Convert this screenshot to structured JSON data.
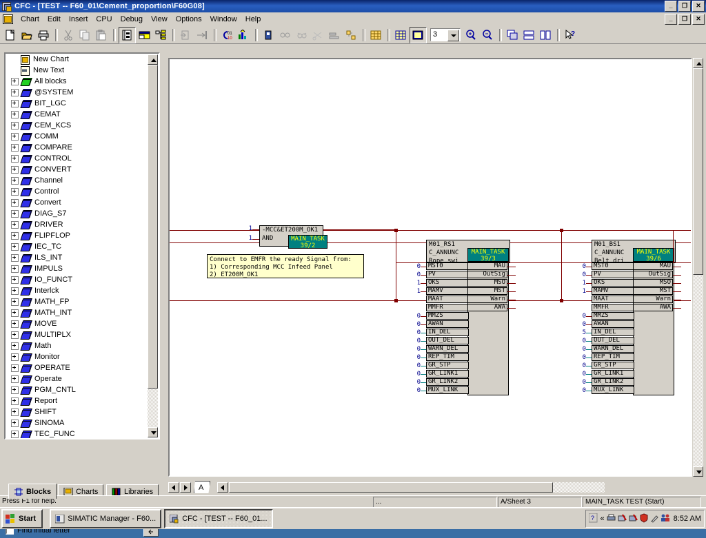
{
  "window": {
    "title": "CFC - [TEST -- F60_01\\Cement_proportion\\F60G08]",
    "min": "_",
    "max": "❐",
    "close": "✕",
    "child_min": "_",
    "child_max": "❐",
    "child_close": "✕"
  },
  "menu": [
    "Chart",
    "Edit",
    "Insert",
    "CPU",
    "Debug",
    "View",
    "Options",
    "Window",
    "Help"
  ],
  "toolbar": {
    "zoom_value": "3",
    "items": [
      "new-icon",
      "open-icon",
      "print-icon",
      "cut-icon",
      "copy-icon",
      "paste-icon",
      "chart-view-icon",
      "sheet-view-icon",
      "tree-view-icon",
      "goto-icon",
      "insert-input-icon",
      "compile-icon",
      "download-icon",
      "test-mode-icon",
      "watch-icon",
      "monitor-icon",
      "disconnect-icon",
      "align-icon",
      "distribute-icon",
      "layout-icon",
      "grid-icon",
      "page-icon",
      "zoom-in-icon",
      "zoom-out-icon",
      "cascade-icon",
      "tile-horiz-icon",
      "tile-vert-icon",
      "help-cursor-icon"
    ]
  },
  "sidebar": {
    "tree": [
      {
        "label": "New Chart",
        "icon": "chart-doc-icon",
        "expandable": false
      },
      {
        "label": "New Text",
        "icon": "text-doc-icon",
        "expandable": false
      },
      {
        "label": "All blocks",
        "icon": "green-book-icon",
        "expandable": true
      },
      {
        "label": "@SYSTEM",
        "icon": "blue-book-icon",
        "expandable": true
      },
      {
        "label": "BIT_LGC",
        "icon": "blue-book-icon",
        "expandable": true
      },
      {
        "label": "CEMAT",
        "icon": "blue-book-icon",
        "expandable": true
      },
      {
        "label": "CEM_KCS",
        "icon": "blue-book-icon",
        "expandable": true
      },
      {
        "label": "COMM",
        "icon": "blue-book-icon",
        "expandable": true
      },
      {
        "label": "COMPARE",
        "icon": "blue-book-icon",
        "expandable": true
      },
      {
        "label": "CONTROL",
        "icon": "blue-book-icon",
        "expandable": true
      },
      {
        "label": "CONVERT",
        "icon": "blue-book-icon",
        "expandable": true
      },
      {
        "label": "Channel",
        "icon": "blue-book-icon",
        "expandable": true
      },
      {
        "label": "Control",
        "icon": "blue-book-icon",
        "expandable": true
      },
      {
        "label": "Convert",
        "icon": "blue-book-icon",
        "expandable": true
      },
      {
        "label": "DIAG_S7",
        "icon": "blue-book-icon",
        "expandable": true
      },
      {
        "label": "DRIVER",
        "icon": "blue-book-icon",
        "expandable": true
      },
      {
        "label": "FLIPFLOP",
        "icon": "blue-book-icon",
        "expandable": true
      },
      {
        "label": "IEC_TC",
        "icon": "blue-book-icon",
        "expandable": true
      },
      {
        "label": "ILS_INT",
        "icon": "blue-book-icon",
        "expandable": true
      },
      {
        "label": "IMPULS",
        "icon": "blue-book-icon",
        "expandable": true
      },
      {
        "label": "IO_FUNCT",
        "icon": "blue-book-icon",
        "expandable": true
      },
      {
        "label": "Interlck",
        "icon": "blue-book-icon",
        "expandable": true
      },
      {
        "label": "MATH_FP",
        "icon": "blue-book-icon",
        "expandable": true
      },
      {
        "label": "MATH_INT",
        "icon": "blue-book-icon",
        "expandable": true
      },
      {
        "label": "MOVE",
        "icon": "blue-book-icon",
        "expandable": true
      },
      {
        "label": "MULTIPLX",
        "icon": "blue-book-icon",
        "expandable": true
      },
      {
        "label": "Math",
        "icon": "blue-book-icon",
        "expandable": true
      },
      {
        "label": "Monitor",
        "icon": "blue-book-icon",
        "expandable": true
      },
      {
        "label": "OPERATE",
        "icon": "blue-book-icon",
        "expandable": true
      },
      {
        "label": "Operate",
        "icon": "blue-book-icon",
        "expandable": true
      },
      {
        "label": "PGM_CNTL",
        "icon": "blue-book-icon",
        "expandable": true
      },
      {
        "label": "Report",
        "icon": "blue-book-icon",
        "expandable": true
      },
      {
        "label": "SHIFT",
        "icon": "blue-book-icon",
        "expandable": true
      },
      {
        "label": "SINOMA",
        "icon": "blue-book-icon",
        "expandable": true
      },
      {
        "label": "TEC_FUNC",
        "icon": "blue-book-icon",
        "expandable": true
      }
    ],
    "tabs": [
      {
        "label": "Blocks",
        "active": true,
        "icon": "blocks-icon"
      },
      {
        "label": "Charts",
        "active": false,
        "icon": "charts-icon"
      },
      {
        "label": "Libraries",
        "active": false,
        "icon": "libraries-icon"
      }
    ],
    "search_value": "",
    "search_placeholder": "",
    "find_initial_letter": "Find initial letter",
    "find_button": "find-binoculars-icon",
    "jump_button": "jump-icon"
  },
  "canvas": {
    "and_block": {
      "name": "-MCC&ET200M_OK1",
      "type": "AND",
      "task": "MAIN_TASK",
      "task_pos": "39/2",
      "input_values": [
        "1",
        "1"
      ]
    },
    "comment": "Connect to EMFR the ready Signal from:\n1) Corresponding MCC Infeed Panel\n2) ET200M_OK1",
    "blocks": [
      {
        "name": "M01_RS1",
        "type": "C_ANNUNC",
        "comment": "Rope swi",
        "task": "MAIN_TASK",
        "task_pos": "39/3",
        "inputs": [
          {
            "pin": "MST0",
            "value": "0"
          },
          {
            "pin": "PV",
            "value": "0"
          },
          {
            "pin": "OKS",
            "value": "1"
          },
          {
            "pin": "MAMV",
            "value": "1"
          },
          {
            "pin": "MAAT",
            "value": ""
          },
          {
            "pin": "MMFR",
            "value": ""
          },
          {
            "pin": "MMZS",
            "value": "0"
          },
          {
            "pin": "AWAN",
            "value": "0"
          },
          {
            "pin": "IN_DEL",
            "value": "0"
          },
          {
            "pin": "OUT_DEL",
            "value": "0"
          },
          {
            "pin": "WARN_DEL",
            "value": "0"
          },
          {
            "pin": "REP_TIM",
            "value": "0"
          },
          {
            "pin": "GR_STP",
            "value": "0"
          },
          {
            "pin": "GR_LINK1",
            "value": "0"
          },
          {
            "pin": "GR_LINK2",
            "value": "0"
          },
          {
            "pin": "MUX_LINK",
            "value": "0"
          }
        ],
        "outputs": [
          "MAU",
          "OutSig",
          "MSO",
          "MST",
          "Warn",
          "AWA"
        ]
      },
      {
        "name": "M01_BS1",
        "type": "C_ANNUNC",
        "comment": "Belt dri",
        "task": "MAIN_TASK",
        "task_pos": "39/6",
        "inputs": [
          {
            "pin": "MST0",
            "value": "0"
          },
          {
            "pin": "PV",
            "value": "0"
          },
          {
            "pin": "OKS",
            "value": "1"
          },
          {
            "pin": "MAMV",
            "value": "1"
          },
          {
            "pin": "MAAT",
            "value": ""
          },
          {
            "pin": "MMFR",
            "value": ""
          },
          {
            "pin": "MMZS",
            "value": "0"
          },
          {
            "pin": "AWAN",
            "value": "0"
          },
          {
            "pin": "IN_DEL",
            "value": "5"
          },
          {
            "pin": "OUT_DEL",
            "value": "0"
          },
          {
            "pin": "WARN_DEL",
            "value": "0"
          },
          {
            "pin": "REP_TIM",
            "value": "0"
          },
          {
            "pin": "GR_STP",
            "value": "0"
          },
          {
            "pin": "GR_LINK1",
            "value": "0"
          },
          {
            "pin": "GR_LINK2",
            "value": "0"
          },
          {
            "pin": "MUX_LINK",
            "value": "0"
          }
        ],
        "outputs": [
          "MAU",
          "OutSig",
          "MSO",
          "MST",
          "Warn",
          "AWA"
        ]
      }
    ],
    "sheet_tab": "A"
  },
  "statusbar": {
    "help": "Press F1 for help.",
    "field1": "...",
    "field2": "A/Sheet 3",
    "field3": "MAIN_TASK  TEST  (Start)"
  },
  "taskbar": {
    "start": "Start",
    "buttons": [
      {
        "label": "SIMATIC Manager - F60...",
        "active": false
      },
      {
        "label": "CFC - [TEST -- F60_01...",
        "active": true
      }
    ],
    "clock": "8:52 AM",
    "tray_icons": [
      "help-icon",
      "chevron-left-icon",
      "printer-icon",
      "net1-icon",
      "net2-icon",
      "shield-icon",
      "tool-icon",
      "users-icon"
    ]
  },
  "colors": {
    "title_blue": "#0a246a",
    "face": "#d4d0c8",
    "wire": "#800000",
    "task_bg": "#008080",
    "task_fg": "#ffff00",
    "comment_bg": "#ffffcc",
    "value_blue": "#00008b"
  }
}
